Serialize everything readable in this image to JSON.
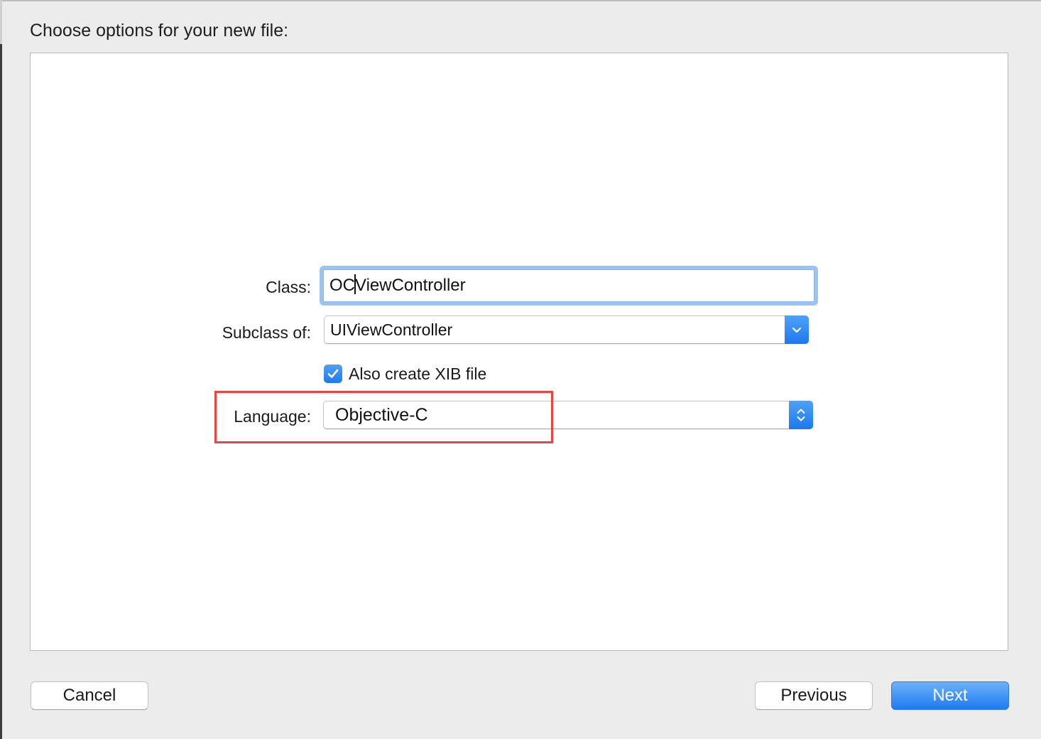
{
  "sheet": {
    "title": "Choose options for your new file:"
  },
  "form": {
    "class_label": "Class:",
    "class_value_before_caret": "OC",
    "class_value_after_caret": "ViewController",
    "subclass_label": "Subclass of:",
    "subclass_value": "UIViewController",
    "xib_checkbox_label": "Also create XIB file",
    "xib_checked": true,
    "language_label": "Language:",
    "language_value": "Objective-C"
  },
  "annotation": {
    "highlight_color": "#e8453c"
  },
  "buttons": {
    "cancel_label": "Cancel",
    "previous_label": "Previous",
    "next_label": "Next"
  },
  "colors": {
    "accent": "#1f7bf0",
    "focus_ring": "#9cc4f3",
    "background": "#ececec"
  },
  "icons": {
    "subclass_popup": "chevron-down-icon",
    "language_popup": "up-down-chevrons-icon",
    "checkbox": "checkmark-icon"
  }
}
